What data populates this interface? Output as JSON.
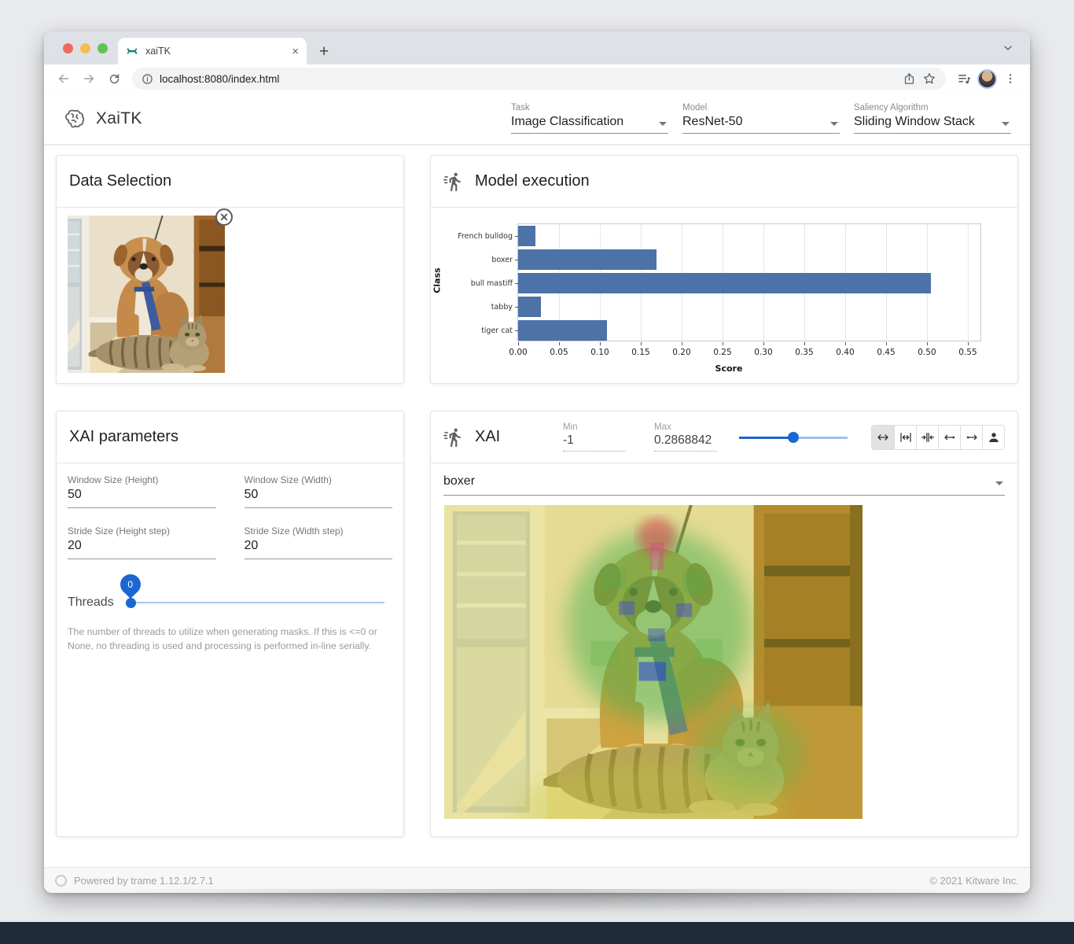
{
  "browser": {
    "tab_title": "xaiTK",
    "tab_close": "×",
    "new_tab": "+",
    "url": "localhost:8080/index.html"
  },
  "header": {
    "app_title": "XaiTK",
    "selects": [
      {
        "label": "Task",
        "value": "Image Classification"
      },
      {
        "label": "Model",
        "value": "ResNet-50"
      },
      {
        "label": "Saliency Algorithm",
        "value": "Sliding Window Stack"
      }
    ]
  },
  "data_selection": {
    "title": "Data Selection",
    "close_glyph": "✕"
  },
  "model_execution": {
    "title": "Model execution"
  },
  "chart_data": {
    "type": "bar",
    "orientation": "horizontal",
    "categories": [
      "French bulldog",
      "boxer",
      "bull mastiff",
      "tabby",
      "tiger cat"
    ],
    "values": [
      0.021,
      0.169,
      0.505,
      0.028,
      0.109
    ],
    "title": "",
    "xlabel": "Score",
    "ylabel": "Class",
    "xlim": [
      0,
      0.5654
    ],
    "xticks": [
      0.0,
      0.05,
      0.1,
      0.15,
      0.2,
      0.25,
      0.3,
      0.35,
      0.4,
      0.45,
      0.5,
      0.55
    ],
    "grid": true,
    "bar_color": "#4c72a8"
  },
  "xai_parameters": {
    "title": "XAI parameters",
    "fields": [
      {
        "label": "Window Size (Height)",
        "value": "50"
      },
      {
        "label": "Window Size (Width)",
        "value": "50"
      },
      {
        "label": "Stride Size (Height step)",
        "value": "20"
      },
      {
        "label": "Stride Size (Width step)",
        "value": "20"
      }
    ],
    "threads": {
      "label": "Threads",
      "value": "0",
      "hint": "The number of threads to utilize when generating masks. If this is <=0 or None, no threading is used and processing is performed in-line serially."
    }
  },
  "xai": {
    "title": "XAI",
    "min_label": "Min",
    "min_value": "-1",
    "max_label": "Max",
    "max_value": "0.2868842",
    "selected_class": "boxer"
  },
  "footer": {
    "powered": "Powered by trame 1.12.1/2.7.1",
    "copyright": "© 2021 Kitware Inc."
  },
  "colors": {
    "accent": "#1a66d2",
    "bar": "#4c72a8",
    "favicon": "#2a9d8f"
  }
}
